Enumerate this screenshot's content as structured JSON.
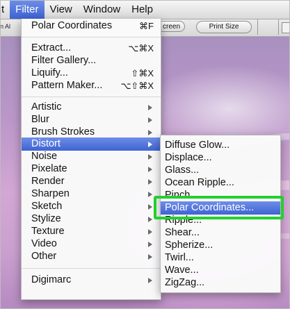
{
  "menubar": {
    "items": [
      {
        "label": "t"
      },
      {
        "label": "Filter"
      },
      {
        "label": "View"
      },
      {
        "label": "Window"
      },
      {
        "label": "Help"
      }
    ]
  },
  "options_bar": {
    "left_fragment": "n Al",
    "screen_button": "creen",
    "print_size_button": "Print Size"
  },
  "filter_menu": {
    "last_filter": {
      "label": "Polar Coordinates",
      "shortcut": "⌘F"
    },
    "extract": {
      "label": "Extract...",
      "shortcut": "⌥⌘X"
    },
    "filter_gallery": {
      "label": "Filter Gallery..."
    },
    "liquify": {
      "label": "Liquify...",
      "shortcut": "⇧⌘X"
    },
    "pattern_maker": {
      "label": "Pattern Maker...",
      "shortcut": "⌥⇧⌘X"
    },
    "artistic": "Artistic",
    "blur": "Blur",
    "brush_strokes": "Brush Strokes",
    "distort": "Distort",
    "noise": "Noise",
    "pixelate": "Pixelate",
    "render": "Render",
    "sharpen": "Sharpen",
    "sketch": "Sketch",
    "stylize": "Stylize",
    "texture": "Texture",
    "video": "Video",
    "other": "Other",
    "digimarc": "Digimarc"
  },
  "distort_menu": {
    "items": [
      "Diffuse Glow...",
      "Displace...",
      "Glass...",
      "Ocean Ripple...",
      "Pinch...",
      "Polar Coordinates...",
      "Ripple...",
      "Shear...",
      "Spherize...",
      "Twirl...",
      "Wave...",
      "ZigZag..."
    ],
    "highlighted_index": 5
  },
  "colors": {
    "selection": "#3f63d2",
    "callout_box": "#21d12a"
  }
}
